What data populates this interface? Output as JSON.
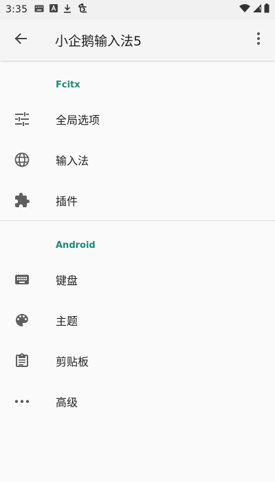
{
  "status_bar": {
    "time": "3:35",
    "left_icons": [
      "keyboard-icon",
      "a-letter-icon",
      "download-icon",
      "app-notification-icon"
    ],
    "right_icons": [
      "wifi-icon",
      "signal-icon",
      "battery-icon"
    ]
  },
  "app_bar": {
    "title": "小企鹅输入法5",
    "back_icon": "arrow-back-icon",
    "menu_icon": "more-vert-icon"
  },
  "sections": [
    {
      "header": "Fcitx",
      "items": [
        {
          "label": "全局选项",
          "icon": "tune-icon"
        },
        {
          "label": "输入法",
          "icon": "globe-icon"
        },
        {
          "label": "插件",
          "icon": "puzzle-icon"
        }
      ]
    },
    {
      "header": "Android",
      "items": [
        {
          "label": "键盘",
          "icon": "keyboard-icon"
        },
        {
          "label": "主题",
          "icon": "palette-icon"
        },
        {
          "label": "剪贴板",
          "icon": "clipboard-icon"
        },
        {
          "label": "高级",
          "icon": "more-horiz-icon"
        }
      ]
    }
  ],
  "colors": {
    "accent": "#1a8a78",
    "icon": "#5f5f5f",
    "background": "#fafafa"
  }
}
